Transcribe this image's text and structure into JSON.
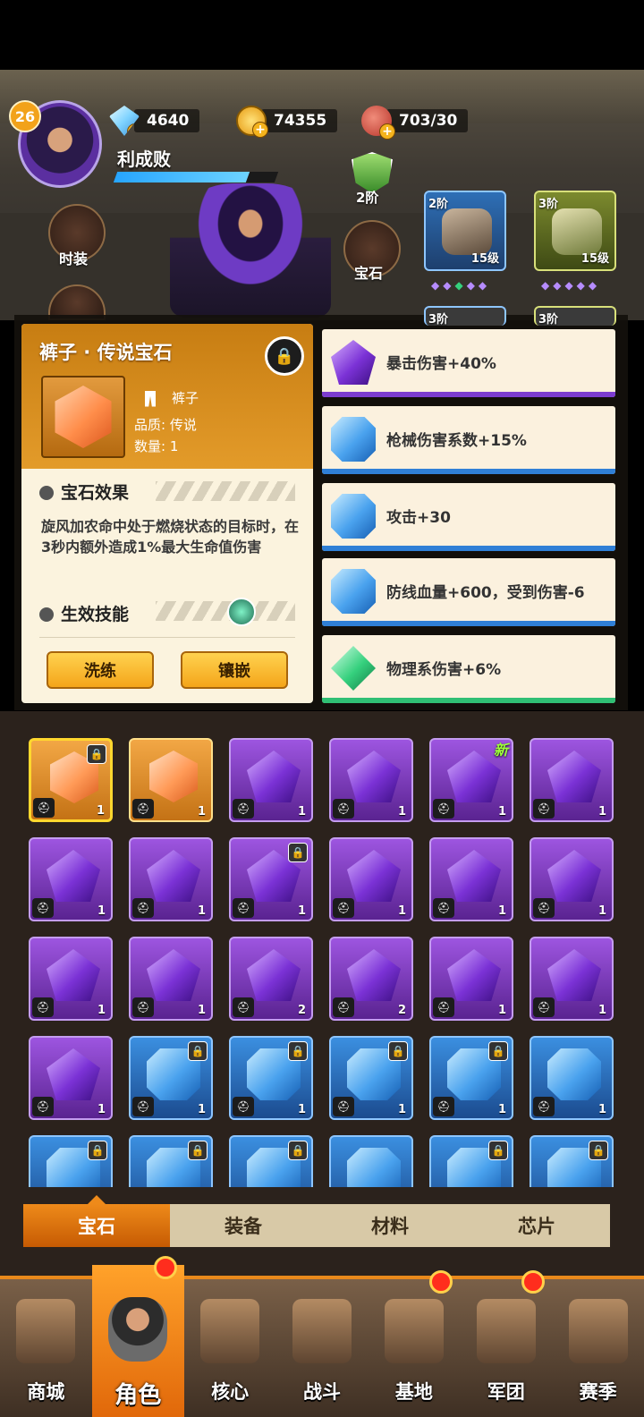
{
  "player": {
    "level": "26",
    "name": "利成败",
    "xp_progress": 0.82
  },
  "resources": {
    "diamonds": "4640",
    "coins": "74355",
    "stamina": "703/30",
    "icons": [
      "diamond-icon",
      "coin-icon",
      "meat-icon"
    ]
  },
  "side_buttons": {
    "costume": "时装",
    "gem": "宝石"
  },
  "tier_badge": "2阶",
  "equipment": [
    {
      "tier": "2阶",
      "level": "15级",
      "name": "helmet"
    },
    {
      "tier": "3阶",
      "level": "15级",
      "name": "gauntlet"
    },
    {
      "tier": "3阶",
      "level": "",
      "name": "equip-3"
    },
    {
      "tier": "3阶",
      "level": "",
      "name": "equip-4"
    }
  ],
  "detail": {
    "title": "裤子 · 传说宝石",
    "slot": "裤子",
    "quality": "品质: 传说",
    "quantity": "数量: 1",
    "effect_header": "宝石效果",
    "effect_text": "旋风加农命中处于燃烧状态的目标时，在3秒内额外造成1%最大生命值伤害",
    "skill_header": "生效技能",
    "btn_refine": "洗练",
    "btn_inlay": "镶嵌"
  },
  "stats": [
    {
      "text": "暴击伤害+40%",
      "gem": "purple",
      "bar": "#7c3cd0"
    },
    {
      "text": "枪械伤害系数+15%",
      "gem": "blue",
      "bar": "#2f7fd6"
    },
    {
      "text": "攻击+30",
      "gem": "blue",
      "bar": "#2f7fd6"
    },
    {
      "text": "防线血量+600，受到伤害-6",
      "gem": "blue",
      "bar": "#2f7fd6"
    },
    {
      "text": "物理系伤害+6%",
      "gem": "green",
      "bar": "#2fbf74"
    }
  ],
  "inventory": [
    {
      "color": "orange",
      "count": "1",
      "locked": true,
      "selected": true
    },
    {
      "color": "orange",
      "count": "1"
    },
    {
      "color": "purple",
      "count": "1"
    },
    {
      "color": "purple",
      "count": "1"
    },
    {
      "color": "purple",
      "count": "1",
      "new": "新"
    },
    {
      "color": "purple",
      "count": "1"
    },
    {
      "color": "purple",
      "count": "1"
    },
    {
      "color": "purple",
      "count": "1"
    },
    {
      "color": "purple",
      "count": "1",
      "locked": true
    },
    {
      "color": "purple",
      "count": "1"
    },
    {
      "color": "purple",
      "count": "1"
    },
    {
      "color": "purple",
      "count": "1"
    },
    {
      "color": "purple",
      "count": "1"
    },
    {
      "color": "purple",
      "count": "1"
    },
    {
      "color": "purple",
      "count": "2"
    },
    {
      "color": "purple",
      "count": "2"
    },
    {
      "color": "purple",
      "count": "1"
    },
    {
      "color": "purple",
      "count": "1"
    },
    {
      "color": "purple",
      "count": "1"
    },
    {
      "color": "blue",
      "count": "1",
      "locked": true
    },
    {
      "color": "blue",
      "count": "1",
      "locked": true
    },
    {
      "color": "blue",
      "count": "1",
      "locked": true
    },
    {
      "color": "blue",
      "count": "1",
      "locked": true
    },
    {
      "color": "blue",
      "count": "1"
    },
    {
      "color": "blue",
      "count": "",
      "locked": true
    },
    {
      "color": "blue",
      "count": "",
      "locked": true
    },
    {
      "color": "blue",
      "count": "",
      "locked": true
    },
    {
      "color": "blue",
      "count": ""
    },
    {
      "color": "blue",
      "count": "",
      "locked": true
    },
    {
      "color": "blue",
      "count": "",
      "locked": true
    }
  ],
  "tabs": [
    "宝石",
    "装备",
    "材料",
    "芯片"
  ],
  "nav": [
    {
      "label": "商城",
      "badge": false
    },
    {
      "label": "角色",
      "badge": true
    },
    {
      "label": "核心",
      "badge": false
    },
    {
      "label": "战斗",
      "badge": false
    },
    {
      "label": "基地",
      "badge": true
    },
    {
      "label": "军团",
      "badge": true
    },
    {
      "label": "赛季",
      "badge": false
    }
  ]
}
